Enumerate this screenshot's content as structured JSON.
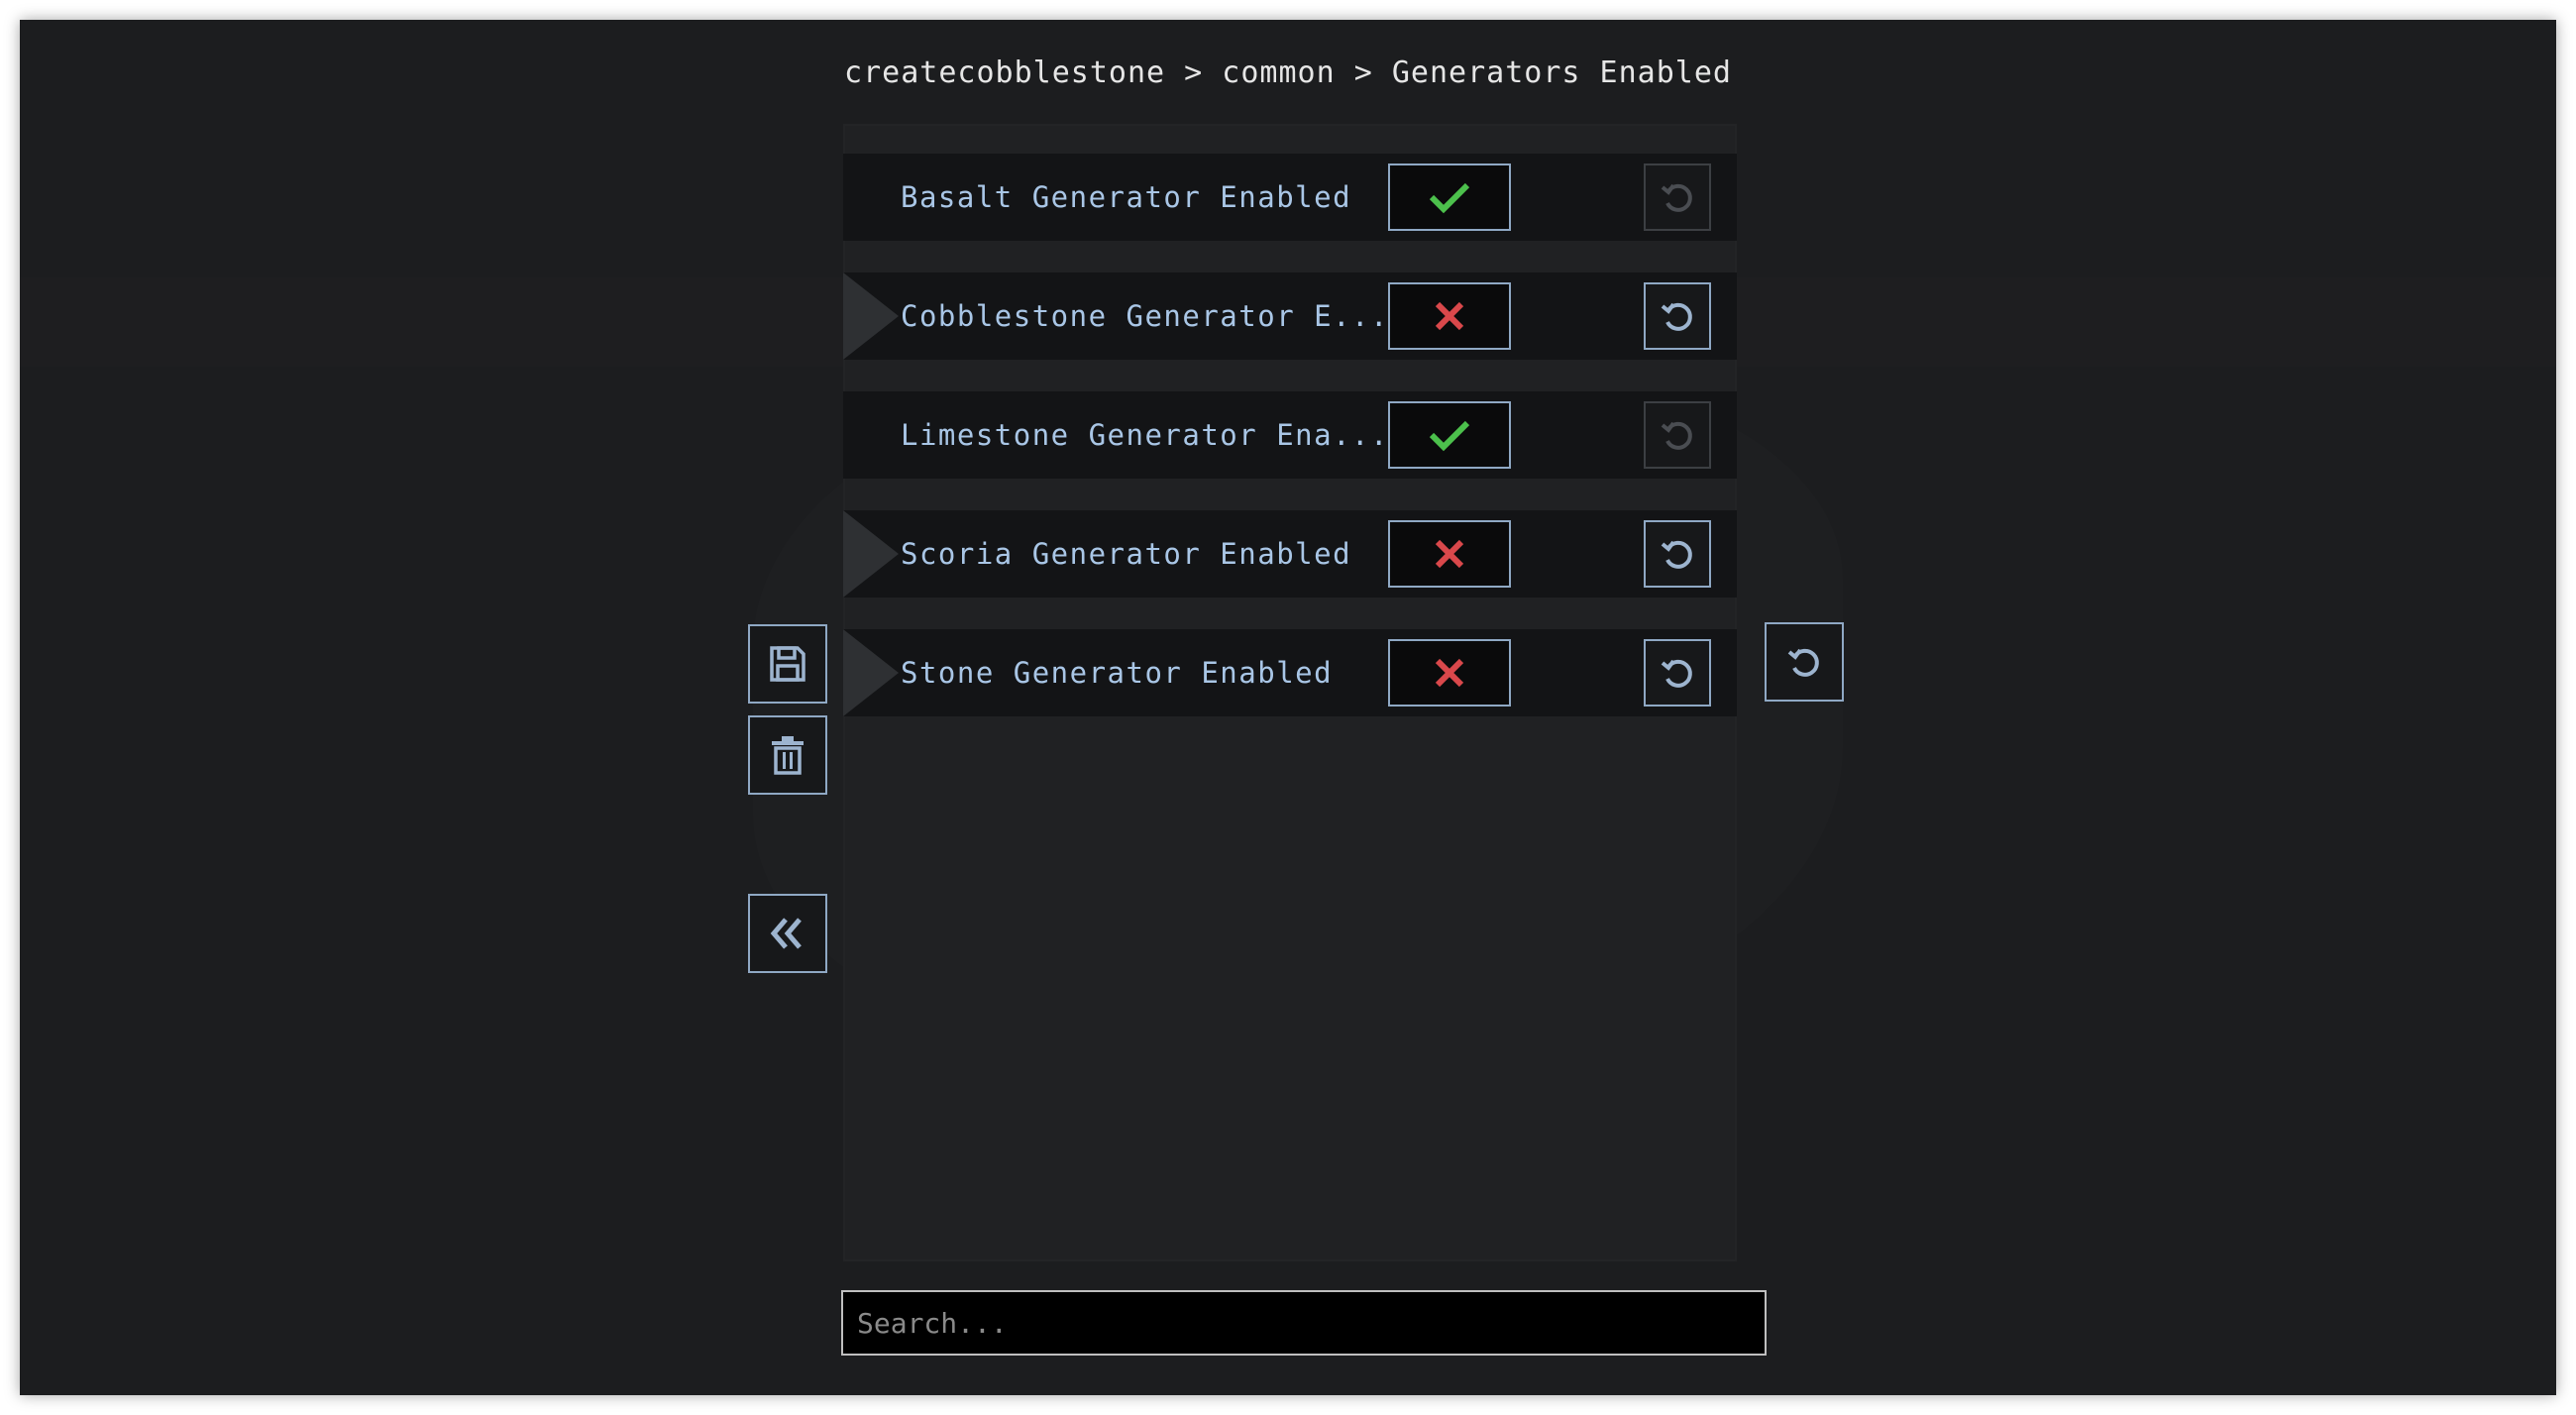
{
  "breadcrumb": "createcobblestone > common > Generators Enabled",
  "colors": {
    "accent": "#8fa8c4",
    "label": "#a9c6e6",
    "check": "#4cc04c",
    "cross": "#d9484b"
  },
  "entries": [
    {
      "label": "Basalt Generator Enabled",
      "value": true,
      "changed": false
    },
    {
      "label": "Cobblestone Generator E...",
      "value": false,
      "changed": true
    },
    {
      "label": "Limestone Generator Ena...",
      "value": true,
      "changed": false
    },
    {
      "label": "Scoria Generator Enabled",
      "value": false,
      "changed": true
    },
    {
      "label": "Stone Generator Enabled",
      "value": false,
      "changed": true
    }
  ],
  "icons": {
    "save": "floppy-disk-icon",
    "delete": "trash-icon",
    "back": "double-chevron-left-icon",
    "reset": "reset-icon",
    "check": "checkmark-icon",
    "cross": "cross-icon"
  },
  "search": {
    "placeholder": "Search...",
    "value": ""
  }
}
